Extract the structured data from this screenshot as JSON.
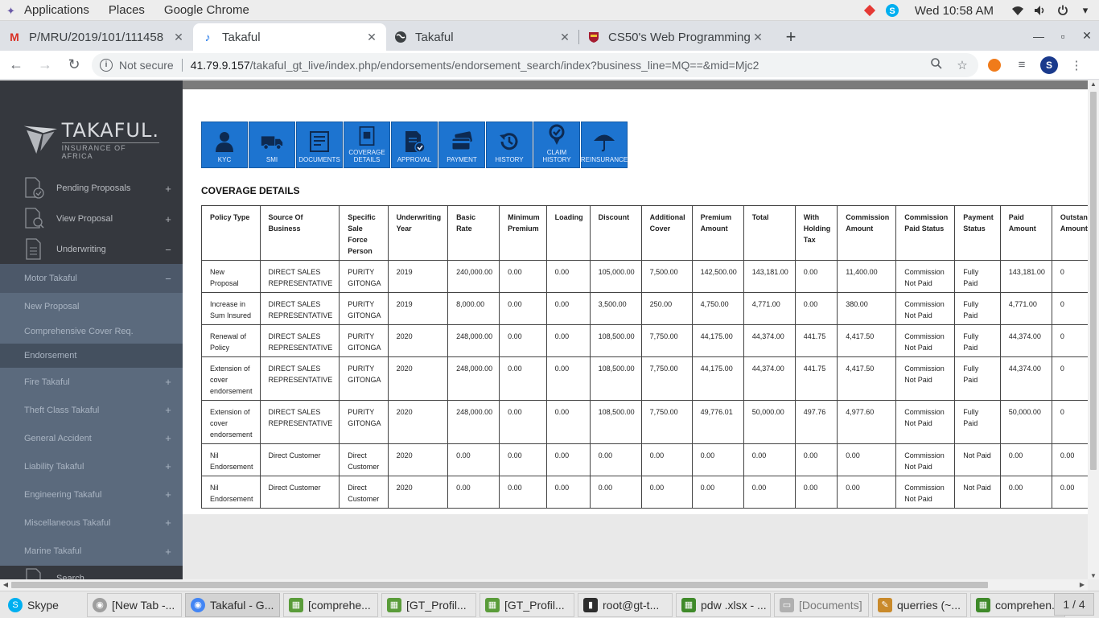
{
  "topbar": {
    "applications": "Applications",
    "places": "Places",
    "app": "Google Chrome",
    "clock": "Wed 10:58 AM"
  },
  "tabs": [
    {
      "title": "P/MRU/2019/101/111458",
      "icon": "gmail-icon"
    },
    {
      "title": "Takaful",
      "icon": "takaful-icon"
    },
    {
      "title": "Takaful",
      "icon": "globe-icon"
    },
    {
      "title": "CS50's Web Programming",
      "icon": "harvard-icon"
    }
  ],
  "address": {
    "not_secure": "Not secure",
    "host": "41.79.9.157",
    "path": "/takaful_gt_live/index.php/endorsements/endorsement_search/index?business_line=MQ==&mid=Mjc2",
    "avatar": "S"
  },
  "sidebar": {
    "logo_big": "TAKAFUL.",
    "logo_small": "INSURANCE OF AFRICA",
    "main_items": [
      {
        "label": "Pending Proposals",
        "toggle": "+"
      },
      {
        "label": "View Proposal",
        "toggle": "+"
      },
      {
        "label": "Underwriting",
        "toggle": "−"
      }
    ],
    "sub_items": [
      {
        "label": "Motor Takaful",
        "toggle": "−"
      },
      {
        "label": "New Proposal",
        "toggle": ""
      },
      {
        "label": "Comprehensive Cover Req.",
        "toggle": ""
      },
      {
        "label": "Endorsement",
        "toggle": ""
      },
      {
        "label": "Fire Takaful",
        "toggle": "+"
      },
      {
        "label": "Theft Class Takaful",
        "toggle": "+"
      },
      {
        "label": "General Accident",
        "toggle": "+"
      },
      {
        "label": "Liability Takaful",
        "toggle": "+"
      },
      {
        "label": "Engineering Takaful",
        "toggle": "+"
      },
      {
        "label": "Miscellaneous Takaful",
        "toggle": "+"
      },
      {
        "label": "Marine Takaful",
        "toggle": "+"
      }
    ],
    "search_label": "Search"
  },
  "iconbar": [
    {
      "label": "KYC",
      "icon": "user-icon"
    },
    {
      "label": "SMI",
      "icon": "truck-icon"
    },
    {
      "label": "DOCUMENTS",
      "icon": "documents-icon"
    },
    {
      "label": "COVERAGE DETAILS",
      "icon": "coverage-icon"
    },
    {
      "label": "APPROVAL",
      "icon": "approval-icon"
    },
    {
      "label": "PAYMENT",
      "icon": "payment-icon"
    },
    {
      "label": "HISTORY",
      "icon": "history-icon"
    },
    {
      "label": "CLAIM HISTORY",
      "icon": "claim-history-icon"
    },
    {
      "label": "REINSURANCE",
      "icon": "umbrella-icon"
    }
  ],
  "section_title": "COVERAGE DETAILS",
  "table": {
    "headers": [
      "Policy Type",
      "Source Of Business",
      "Specific Sale Force Person",
      "Underwriting Year",
      "Basic Rate",
      "Minimum Premium",
      "Loading",
      "Discount",
      "Additional Cover",
      "Premium Amount",
      "Total",
      "With Holding Tax",
      "Commission Amount",
      "Commission Paid Status",
      "Payment Status",
      "Paid Amount",
      "Outstanding Amount"
    ],
    "rows": [
      [
        "New Proposal",
        "DIRECT SALES REPRESENTATIVE",
        "PURITY GITONGA",
        "2019",
        "240,000.00",
        "0.00",
        "0.00",
        "105,000.00",
        "7,500.00",
        "142,500.00",
        "143,181.00",
        "0.00",
        "11,400.00",
        "Commission Not Paid",
        "Fully Paid",
        "143,181.00",
        "0"
      ],
      [
        "Increase in Sum Insured",
        "DIRECT SALES REPRESENTATIVE",
        "PURITY GITONGA",
        "2019",
        "8,000.00",
        "0.00",
        "0.00",
        "3,500.00",
        "250.00",
        "4,750.00",
        "4,771.00",
        "0.00",
        "380.00",
        "Commission Not Paid",
        "Fully Paid",
        "4,771.00",
        "0"
      ],
      [
        "Renewal of Policy",
        "DIRECT SALES REPRESENTATIVE",
        "PURITY GITONGA",
        "2020",
        "248,000.00",
        "0.00",
        "0.00",
        "108,500.00",
        "7,750.00",
        "44,175.00",
        "44,374.00",
        "441.75",
        "4,417.50",
        "Commission Not Paid",
        "Fully Paid",
        "44,374.00",
        "0"
      ],
      [
        "Extension of cover endorsement",
        "DIRECT SALES REPRESENTATIVE",
        "PURITY GITONGA",
        "2020",
        "248,000.00",
        "0.00",
        "0.00",
        "108,500.00",
        "7,750.00",
        "44,175.00",
        "44,374.00",
        "441.75",
        "4,417.50",
        "Commission Not Paid",
        "Fully Paid",
        "44,374.00",
        "0"
      ],
      [
        "Extension of cover endorsement",
        "DIRECT SALES REPRESENTATIVE",
        "PURITY GITONGA",
        "2020",
        "248,000.00",
        "0.00",
        "0.00",
        "108,500.00",
        "7,750.00",
        "49,776.01",
        "50,000.00",
        "497.76",
        "4,977.60",
        "Commission Not Paid",
        "Fully Paid",
        "50,000.00",
        "0"
      ],
      [
        "Nil Endorsement",
        "Direct Customer",
        "Direct Customer",
        "2020",
        "0.00",
        "0.00",
        "0.00",
        "0.00",
        "0.00",
        "0.00",
        "0.00",
        "0.00",
        "0.00",
        "Commission Not Paid",
        "Not Paid",
        "0.00",
        "0.00"
      ],
      [
        "Nil Endorsement",
        "Direct Customer",
        "Direct Customer",
        "2020",
        "0.00",
        "0.00",
        "0.00",
        "0.00",
        "0.00",
        "0.00",
        "0.00",
        "0.00",
        "0.00",
        "Commission Not Paid",
        "Not Paid",
        "0.00",
        "0.00"
      ]
    ]
  },
  "taskbar": [
    {
      "label": "Skype",
      "icon": "skype-icon",
      "color": "#00aff0"
    },
    {
      "label": "[New Tab -...",
      "icon": "chrome-icon",
      "color": "#9e9e9e"
    },
    {
      "label": "Takaful - G...",
      "icon": "chrome-icon",
      "color": "#4285f4"
    },
    {
      "label": "[comprehe...",
      "icon": "spreadsheet-icon",
      "color": "#5a9c3a"
    },
    {
      "label": "[GT_Profil...",
      "icon": "spreadsheet-icon",
      "color": "#5a9c3a"
    },
    {
      "label": "[GT_Profil...",
      "icon": "spreadsheet-icon",
      "color": "#5a9c3a"
    },
    {
      "label": "root@gt-t...",
      "icon": "terminal-icon",
      "color": "#2e2e2e"
    },
    {
      "label": "pdw .xlsx - ...",
      "icon": "spreadsheet-icon",
      "color": "#3f8a2a"
    },
    {
      "label": "[Documents]",
      "icon": "folder-icon",
      "color": "#b0b0b0"
    },
    {
      "label": "querries (~...",
      "icon": "text-editor-icon",
      "color": "#c98a2b"
    },
    {
      "label": "comprehen...",
      "icon": "spreadsheet-icon",
      "color": "#3f8a2a"
    }
  ],
  "pager": "1 / 4"
}
